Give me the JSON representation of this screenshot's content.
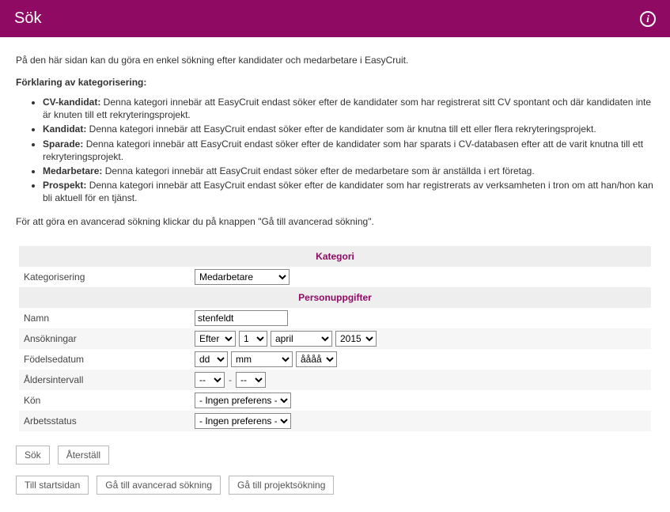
{
  "header": {
    "title": "Sök",
    "info_glyph": "i"
  },
  "intro": "På den här sidan kan du göra en enkel sökning efter kandidater och medarbetare i EasyCruit.",
  "categories_heading": "Förklaring av kategorisering:",
  "categories": [
    {
      "name": "CV-kandidat:",
      "desc": " Denna kategori innebär att EasyCruit endast söker efter de kandidater som har registrerat sitt CV spontant och där kandidaten inte är knuten till ett rekryteringsprojekt."
    },
    {
      "name": "Kandidat:",
      "desc": " Denna kategori innebär att EasyCruit endast söker efter de kandidater som är knutna till ett eller flera rekryteringsprojekt."
    },
    {
      "name": "Sparade:",
      "desc": " Denna kategori innebär att EasyCruit endast söker efter de kandidater som har sparats i CV-databasen efter att de varit knutna till ett rekryteringsprojekt."
    },
    {
      "name": "Medarbetare:",
      "desc": " Denna kategori innebär att EasyCruit endast söker efter de medarbetare som är anställda i ert företag."
    },
    {
      "name": "Prospekt:",
      "desc": " Denna kategori innebär att EasyCruit endast söker efter de kandidater som har registrerats av verksamheten i tron om att han/hon kan bli aktuell för en tjänst."
    }
  ],
  "advanced_note": "För att göra en avancerad sökning klickar du på knappen \"Gå till avancerad sökning\".",
  "section_category": "Kategori",
  "section_personal": "Personuppgifter",
  "labels": {
    "categorization": "Kategorisering",
    "name": "Namn",
    "applications": "Ansökningar",
    "birthdate": "Födelsedatum",
    "age_range": "Åldersintervall",
    "gender": "Kön",
    "work_status": "Arbetsstatus"
  },
  "values": {
    "categorization": "Medarbetare",
    "name": "stenfeldt",
    "app_when": "Efter",
    "app_day": "1",
    "app_month": "april",
    "app_year": "2015",
    "birth_day": "dd",
    "birth_month": "mm",
    "birth_year": "åååå",
    "age_from": "--",
    "age_to": "--",
    "age_sep": "-",
    "gender": "- Ingen preferens -",
    "work_status": "- Ingen preferens -"
  },
  "buttons": {
    "search": "Sök",
    "reset": "Återställ",
    "home": "Till startsidan",
    "advanced": "Gå till avancerad sökning",
    "project": "Gå till projektsökning"
  }
}
